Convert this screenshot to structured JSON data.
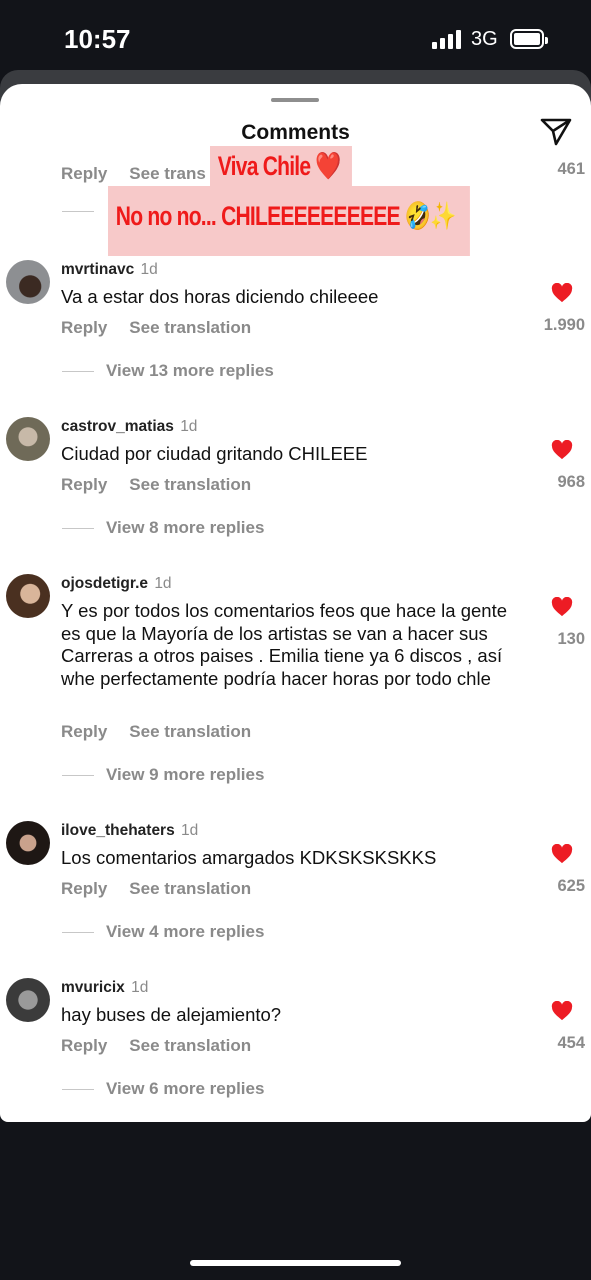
{
  "status_bar": {
    "time": "10:57",
    "network": "3G"
  },
  "sheet": {
    "title": "Comments"
  },
  "top_partial": {
    "reply": "Reply",
    "see_translation": "See trans",
    "likes": "461"
  },
  "stickers": {
    "line1": "Viva Chile ❤️",
    "line2": "No no no... CHILEEEEEEEEEE 🤣✨"
  },
  "comments": [
    {
      "username": "mvrtinavc",
      "age": "1d",
      "text": "Va a estar dos horas diciendo chileeee",
      "reply": "Reply",
      "see_translation": "See translation",
      "likes": "1.990",
      "view_replies": "View 13 more replies"
    },
    {
      "username": "castrov_matias",
      "age": "1d",
      "text": "Ciudad por ciudad gritando CHILEEE",
      "reply": "Reply",
      "see_translation": "See translation",
      "likes": "968",
      "view_replies": "View 8 more replies"
    },
    {
      "username": "ojosdetigr.e",
      "age": "1d",
      "text": "Y es por todos los comentarios feos que hace la gente es que la Mayoría de los artistas se van a hacer sus Carreras a otros paises . Emilia tiene ya 6 discos , así whe perfectamente podría hacer horas por todo chle",
      "reply": "Reply",
      "see_translation": "See translation",
      "likes": "130",
      "view_replies": "View 9 more replies"
    },
    {
      "username": "ilove_thehaters",
      "age": "1d",
      "text": "Los comentarios amargados KDKSKSKSKKS",
      "reply": "Reply",
      "see_translation": "See translation",
      "likes": "625",
      "view_replies": "View 4 more replies"
    },
    {
      "username": "mvuricix",
      "age": "1d",
      "text": "hay buses de alejamiento?",
      "reply": "Reply",
      "see_translation": "See translation",
      "likes": "454",
      "view_replies": "View 6 more replies"
    }
  ],
  "colors": {
    "heart": "#ed1c24",
    "sticker_text": "#ef1a1a",
    "sticker_bg": "#f7c9c9"
  }
}
